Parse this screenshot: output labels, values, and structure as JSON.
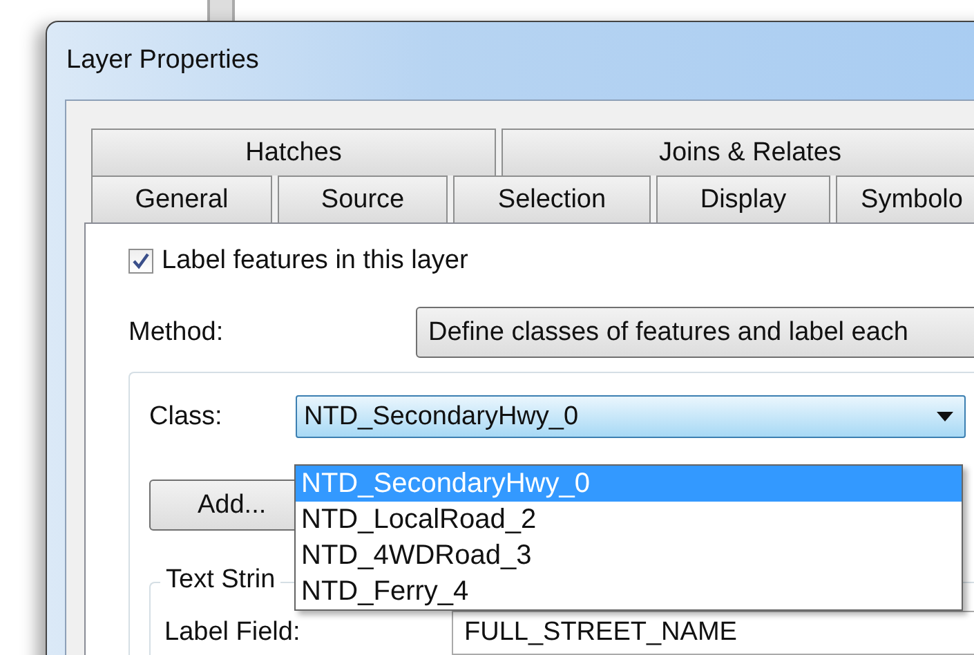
{
  "window": {
    "title": "Layer Properties"
  },
  "tab_rows": [
    [
      {
        "label": "Hatches",
        "selected": false
      },
      {
        "label": "Joins & Relates",
        "selected": false
      }
    ],
    [
      {
        "label": "General",
        "selected": false
      },
      {
        "label": "Source",
        "selected": false
      },
      {
        "label": "Selection",
        "selected": false
      },
      {
        "label": "Display",
        "selected": false
      },
      {
        "label": "Symbolo",
        "selected": false
      }
    ]
  ],
  "label_checkbox": {
    "label": "Label features in this layer",
    "checked": true
  },
  "method": {
    "label": "Method:",
    "value": "Define classes of features and label each"
  },
  "class_field": {
    "label": "Class:",
    "value": "NTD_SecondaryHwy_0",
    "expanded": true,
    "options": [
      {
        "label": "NTD_SecondaryHwy_0",
        "selected": true
      },
      {
        "label": "NTD_LocalRoad_2",
        "selected": false
      },
      {
        "label": "NTD_4WDRoad_3",
        "selected": false
      },
      {
        "label": "NTD_Ferry_4",
        "selected": false
      }
    ]
  },
  "add_button": "Add...",
  "text_string_group": {
    "title": "Text Strin",
    "label_field": {
      "label": "Label Field:",
      "value": "FULL_STREET_NAME"
    }
  }
}
